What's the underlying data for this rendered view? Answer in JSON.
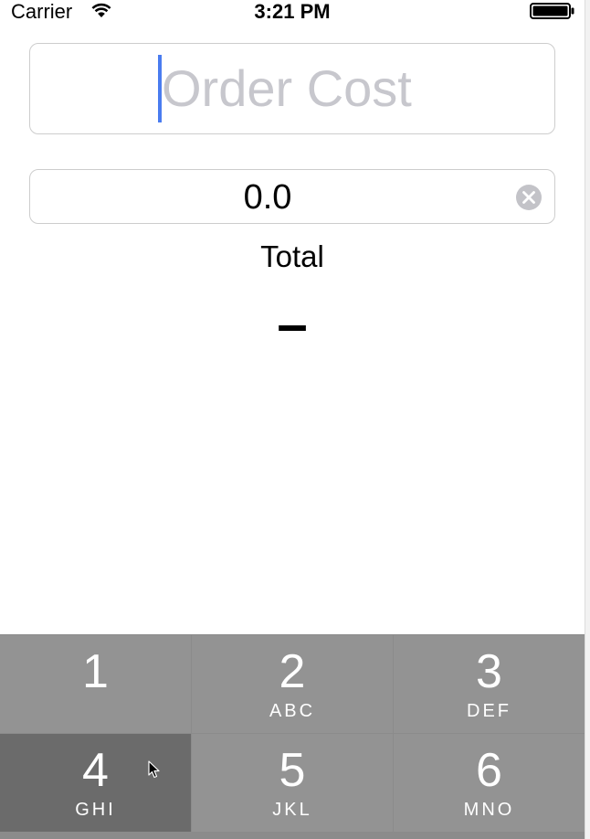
{
  "status_bar": {
    "carrier": "Carrier",
    "time": "3:21 PM",
    "icons": [
      "wifi-icon",
      "battery-icon"
    ]
  },
  "order_cost": {
    "value": "",
    "placeholder": "Order Cost"
  },
  "tip_field": {
    "value": "0.0",
    "clear_icon": "clear-icon"
  },
  "total": {
    "label": "Total",
    "value": "–"
  },
  "keypad": {
    "keys": [
      {
        "digit": "1",
        "letters": ""
      },
      {
        "digit": "2",
        "letters": "ABC"
      },
      {
        "digit": "3",
        "letters": "DEF"
      },
      {
        "digit": "4",
        "letters": "GHI"
      },
      {
        "digit": "5",
        "letters": "JKL"
      },
      {
        "digit": "6",
        "letters": "MNO"
      }
    ],
    "pressed_key": "4"
  },
  "colors": {
    "caret": "#4a7cf0",
    "placeholder": "#c7c7cd",
    "key_background": "#939393",
    "key_pressed": "#6b6b6b",
    "keypad_separator": "#8b8b8b"
  }
}
